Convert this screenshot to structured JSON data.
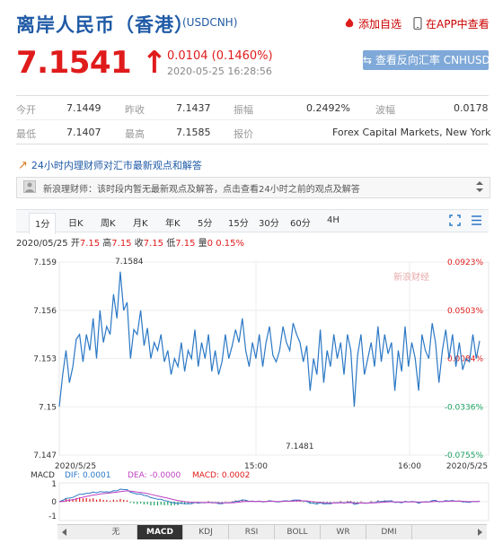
{
  "header": {
    "name": "离岸人民币（香港）",
    "code": "(USDCNH)",
    "add_watch": "添加自选",
    "app_view": "在APP中查看"
  },
  "quote": {
    "price": "7.1541",
    "arrow": "↑",
    "change": "0.0104 (0.1460%)",
    "timestamp": "2020-05-25 16:28:56",
    "reverse_button": "查看反向汇率 CNHUSD"
  },
  "stats": {
    "row1": [
      {
        "label": "今开",
        "value": "7.1449"
      },
      {
        "label": "昨收",
        "value": "7.1437"
      },
      {
        "label": "振幅",
        "value": "0.2492%"
      },
      {
        "label": "波幅",
        "value": "0.0178"
      }
    ],
    "row2": [
      {
        "label": "最低",
        "value": "7.1407"
      },
      {
        "label": "最高",
        "value": "7.1585"
      },
      {
        "label": "报价",
        "value": "Forex Capital Markets, New York"
      }
    ]
  },
  "news": {
    "title": "24小时内理财师对汇市最新观点和解答",
    "text": "新浪理财师：该时段内暂无最新观点及解答，点击查看24小时之前的观点及解答"
  },
  "tabs": [
    "1分",
    "日K",
    "周K",
    "月K",
    "年K",
    "5分",
    "15分",
    "30分",
    "60分",
    "4H"
  ],
  "ohlc": {
    "date": "2020/05/25",
    "open_label": "开",
    "open": "7.15",
    "high_label": "高",
    "high": "7.15",
    "close_label": "收",
    "close": "7.15",
    "low_label": "低",
    "low": "7.15",
    "vol_label": "量",
    "vol": "0",
    "pct": "0.15%"
  },
  "chart_data": {
    "type": "line",
    "y_ticks": [
      "7.159",
      "7.156",
      "7.153",
      "7.15",
      "7.147"
    ],
    "pct_ticks": [
      "0.0923%",
      "0.0503%",
      "0.0084%",
      "-0.0336%",
      "-0.0755%"
    ],
    "x_ticks": [
      "2020/5/25",
      "15:00",
      "16:00",
      "2020/5/25"
    ],
    "max_label": "7.1584",
    "min_label": "7.1481",
    "watermark": "新浪财经",
    "ylim": [
      7.147,
      7.159
    ],
    "values": [
      7.15,
      7.152,
      7.1535,
      7.1515,
      7.1525,
      7.1542,
      7.1545,
      7.1528,
      7.1545,
      7.1535,
      7.1555,
      7.153,
      7.156,
      7.154,
      7.155,
      7.1545,
      7.157,
      7.1555,
      7.1584,
      7.156,
      7.1565,
      7.153,
      7.1548,
      7.1545,
      7.156,
      7.1538,
      7.1549,
      7.153,
      7.154,
      7.1535,
      7.1545,
      7.1528,
      7.1535,
      7.152,
      7.153,
      7.1525,
      7.154,
      7.1522,
      7.1535,
      7.153,
      7.1548,
      7.1525,
      7.154,
      7.153,
      7.1545,
      7.1522,
      7.1535,
      7.152,
      7.1528,
      7.1545,
      7.153,
      7.1538,
      7.1548,
      7.154,
      7.1555,
      7.1535,
      7.1525,
      7.154,
      7.153,
      7.1545,
      7.1525,
      7.154,
      7.155,
      7.1532,
      7.1528,
      7.1535,
      7.155,
      7.154,
      7.1535,
      7.1552,
      7.1545,
      7.154,
      7.1528,
      7.1538,
      7.151,
      7.153,
      7.152,
      7.1548,
      7.1515,
      7.1535,
      7.1525,
      7.1545,
      7.153,
      7.154,
      7.152,
      7.1545,
      7.1535,
      7.15,
      7.1532,
      7.1545,
      7.152,
      7.153,
      7.154,
      7.1525,
      7.155,
      7.1528,
      7.1545,
      7.1533,
      7.154,
      7.151,
      7.1535,
      7.1522,
      7.155,
      7.1525,
      7.154,
      7.153,
      7.151,
      7.1545,
      7.1535,
      7.153,
      7.1552,
      7.154,
      7.1515,
      7.1535,
      7.1548,
      7.153,
      7.1545,
      7.1525,
      7.154,
      7.1523,
      7.153,
      7.1528,
      7.1545,
      7.153,
      7.1541
    ],
    "macd": {
      "label": "MACD",
      "dif": "DIF: 0.0001",
      "dea": "DEA: -0.0000",
      "macd": "MACD: 0.0002",
      "y_ticks": [
        "1",
        "0",
        "-1"
      ]
    }
  },
  "bottom_tabs": [
    "无",
    "MACD",
    "KDJ",
    "RSI",
    "BOLL",
    "WR",
    "DMI"
  ],
  "colors": {
    "up": "#e01b1b",
    "down": "#1aa260",
    "line": "#2b78c5",
    "brand": "#1f5aa6"
  }
}
